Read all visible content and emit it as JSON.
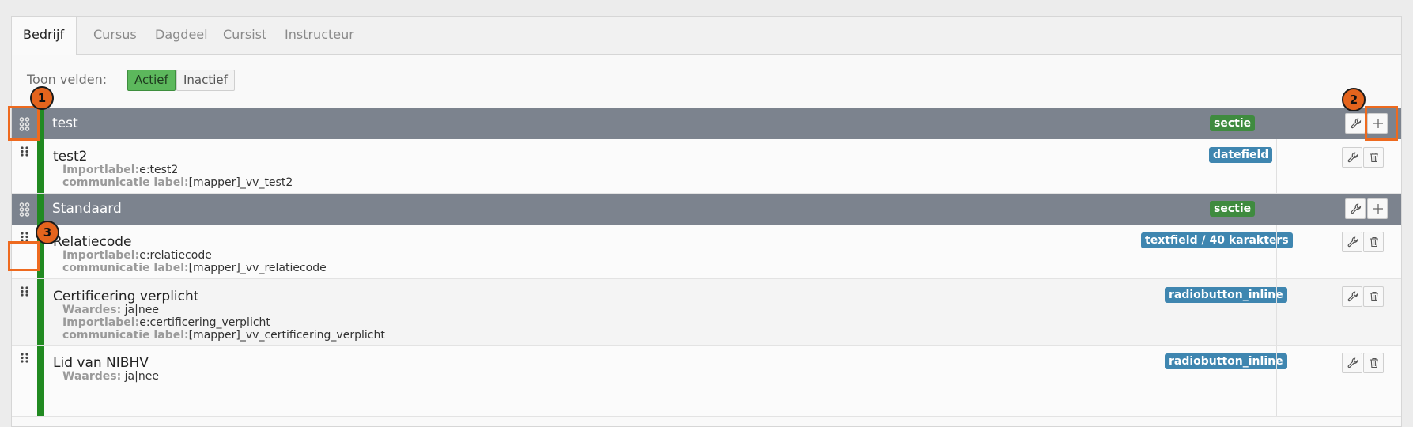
{
  "tabs": [
    "Bedrijf",
    "Cursus",
    "Dagdeel",
    "Cursist",
    "Instructeur"
  ],
  "filter": {
    "label": "Toon velden:",
    "active_label": "Actief",
    "inactive_label": "Inactief"
  },
  "sections": [
    {
      "title": "test",
      "badge": "sectie",
      "fields": [
        {
          "title": "test2",
          "badge": "datefield",
          "meta": [
            {
              "key": "Importlabel:",
              "value": "e:test2"
            },
            {
              "key": "communicatie label:",
              "value": "[mapper]_vv_test2"
            }
          ]
        }
      ]
    },
    {
      "title": "Standaard",
      "badge": "sectie",
      "fields": [
        {
          "title": "Relatiecode",
          "badge": "textfield / 40 karakters",
          "meta": [
            {
              "key": "Importlabel:",
              "value": "e:relatiecode"
            },
            {
              "key": "communicatie label:",
              "value": "[mapper]_vv_relatiecode"
            }
          ]
        },
        {
          "title": "Certificering verplicht",
          "badge": "radiobutton_inline",
          "meta": [
            {
              "key": "Waardes:",
              "value": " ja|nee"
            },
            {
              "key": "Importlabel:",
              "value": "e:certificering_verplicht"
            },
            {
              "key": "communicatie label:",
              "value": "[mapper]_vv_certificering_verplicht"
            }
          ]
        },
        {
          "title": "Lid van NIBHV",
          "badge": "radiobutton_inline",
          "meta": [
            {
              "key": "Waardes:",
              "value": " ja|nee"
            }
          ]
        }
      ]
    }
  ],
  "markers": [
    "1",
    "2",
    "3"
  ],
  "icons": {
    "drag": "drag-handle-icon",
    "edit": "wrench-icon",
    "add": "plus-icon",
    "delete": "trash-icon"
  },
  "colors": {
    "section_bg": "#7c838e",
    "active_bar": "#218a21",
    "type_badge": "#3f86b0",
    "section_badge": "#3f8b3f",
    "highlight": "#ee6a1f"
  }
}
